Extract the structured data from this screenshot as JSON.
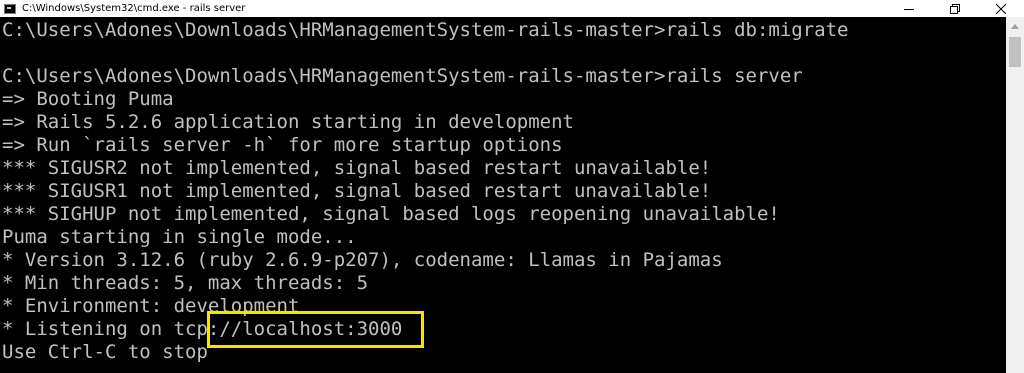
{
  "window": {
    "title": "C:\\Windows\\System32\\cmd.exe - rails  server",
    "icon": "cmd-icon",
    "controls": [
      "minimize-icon",
      "maximize-icon",
      "close-icon"
    ]
  },
  "console": {
    "lines": [
      "C:\\Users\\Adones\\Downloads\\HRManagementSystem-rails-master>rails db:migrate",
      "",
      "C:\\Users\\Adones\\Downloads\\HRManagementSystem-rails-master>rails server",
      "=> Booting Puma",
      "=> Rails 5.2.6 application starting in development",
      "=> Run `rails server -h` for more startup options",
      "*** SIGUSR2 not implemented, signal based restart unavailable!",
      "*** SIGUSR1 not implemented, signal based restart unavailable!",
      "*** SIGHUP not implemented, signal based logs reopening unavailable!",
      "Puma starting in single mode...",
      "* Version 3.12.6 (ruby 2.6.9-p207), codename: Llamas in Pajamas",
      "* Min threads: 5, max threads: 5",
      "* Environment: development",
      "* Listening on tcp://localhost:3000",
      "Use Ctrl-C to stop"
    ]
  },
  "colors": {
    "console_bg": "#000000",
    "console_text": "#c0c0c0",
    "highlight": "#f2e600"
  }
}
